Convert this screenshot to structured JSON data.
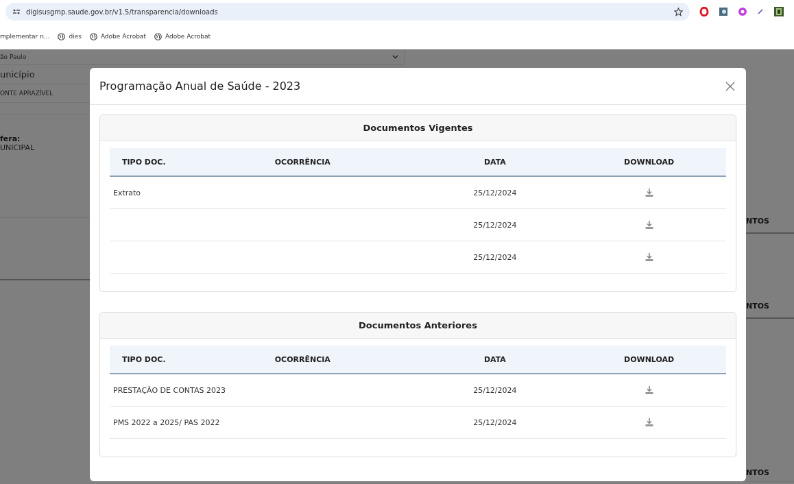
{
  "browser": {
    "url": "digisusgmp.saude.gov.br/v1.5/transparencia/downloads",
    "bookmarks": [
      {
        "label": "mplementar n...",
        "kind": "plain"
      },
      {
        "label": "dies",
        "kind": "globe"
      },
      {
        "label": "Adobe Acrobat",
        "kind": "globe"
      },
      {
        "label": "Adobe Acrobat",
        "kind": "globe"
      }
    ]
  },
  "background": {
    "state_select": "ão Paulo",
    "municipio_label": "unicípio",
    "municipio_value": "ONTE APRAZÍVEL",
    "esfera_label": "fera:",
    "esfera_value": "UNICIPAL",
    "right_labels": [
      "NTOS",
      "NTOS",
      "NTOS"
    ]
  },
  "modal": {
    "title": "Programação Anual de Saúde - 2023",
    "sections": [
      {
        "title": "Documentos Vigentes",
        "columns": [
          "TIPO DOC.",
          "OCORRÊNCIA",
          "DATA",
          "DOWNLOAD"
        ],
        "rows": [
          {
            "tipo_doc": "Extrato",
            "data": "25/12/2024"
          },
          {
            "data": "25/12/2024"
          },
          {
            "data": "25/12/2024"
          }
        ]
      },
      {
        "title": "Documentos Anteriores",
        "columns": [
          "TIPO DOC.",
          "OCORRÊNCIA",
          "DATA",
          "DOWNLOAD"
        ],
        "rows": [
          {
            "tipo_doc": "PRESTAÇÃO DE CONTAS 2023",
            "data": "25/12/2024"
          },
          {
            "tipo_doc": "PMS 2022 a 2025/ PAS 2022",
            "data": "25/12/2024"
          }
        ]
      }
    ]
  }
}
